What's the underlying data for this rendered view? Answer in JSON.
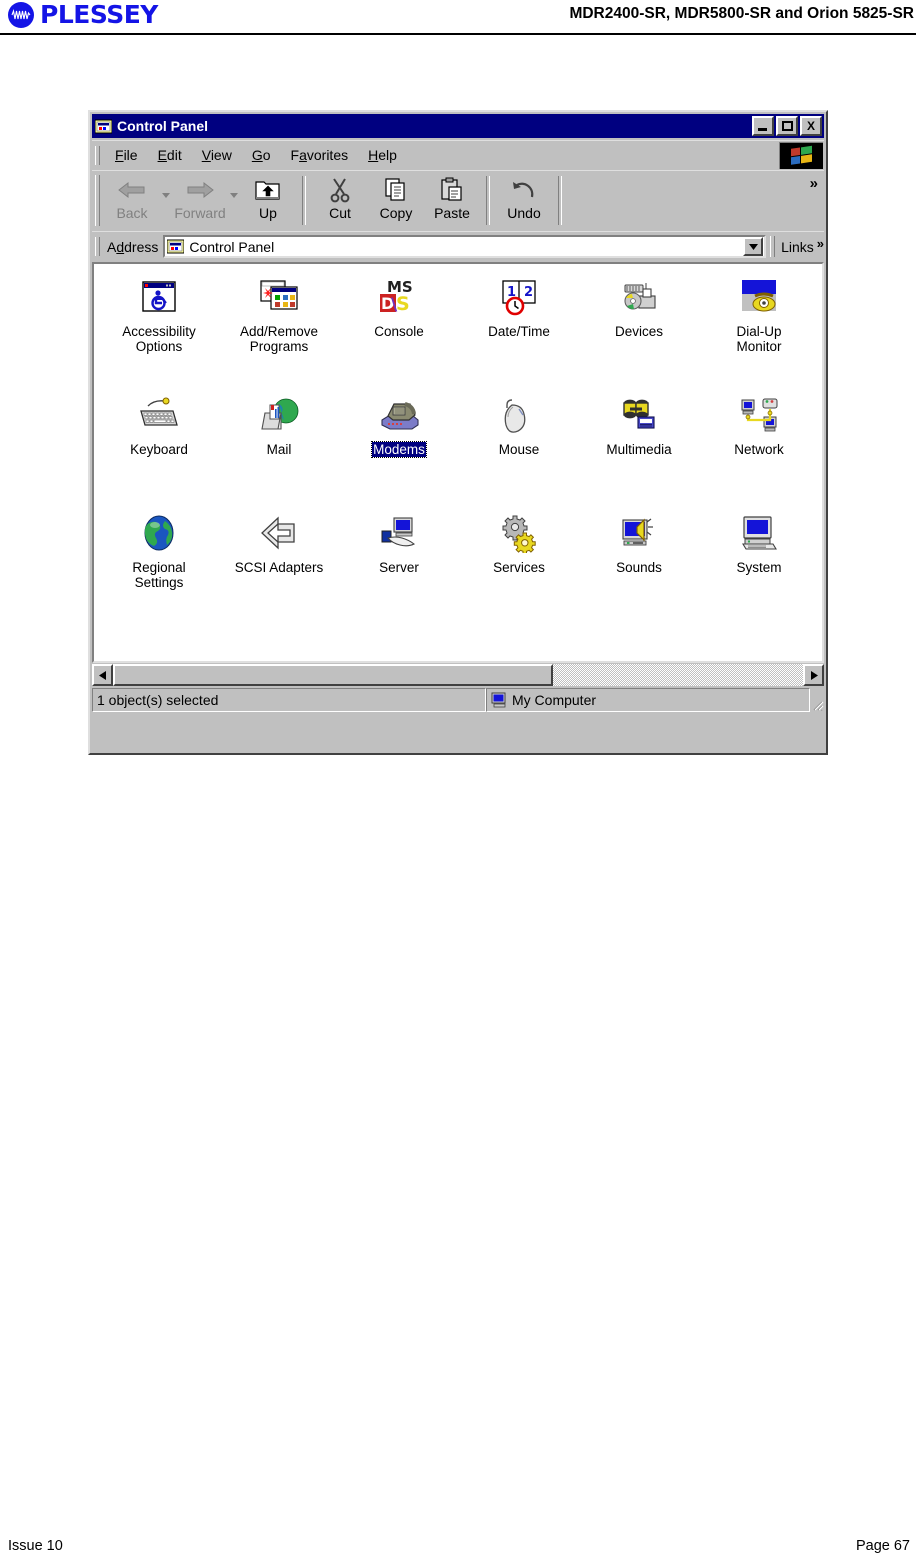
{
  "page": {
    "brand_name": "PLESSEY",
    "doc_title": "MDR2400-SR, MDR5800-SR and Orion 5825-SR",
    "footer_left": "Issue 10",
    "footer_right": "Page 67",
    "brand_color": "#1414e6"
  },
  "window": {
    "title": "Control Panel",
    "title_icon": "control-panel-folder-icon",
    "titlebar_color": "#000080",
    "buttons": {
      "minimize": "_",
      "maximize": "□",
      "close": "X"
    }
  },
  "menu": {
    "items": [
      {
        "label": "File",
        "accel": "F"
      },
      {
        "label": "Edit",
        "accel": "E"
      },
      {
        "label": "View",
        "accel": "V"
      },
      {
        "label": "Go",
        "accel": "G"
      },
      {
        "label": "Favorites",
        "accel": "a"
      },
      {
        "label": "Help",
        "accel": "H"
      }
    ],
    "logo": "windows-flag-logo"
  },
  "toolbar": {
    "buttons": [
      {
        "label": "Back",
        "icon": "back-arrow-icon",
        "disabled": true,
        "has_dropdown": true
      },
      {
        "label": "Forward",
        "icon": "forward-arrow-icon",
        "disabled": true,
        "has_dropdown": true
      },
      {
        "label": "Up",
        "icon": "up-folder-icon",
        "disabled": false,
        "has_dropdown": false
      },
      {
        "label": "Cut",
        "icon": "scissors-icon",
        "disabled": false,
        "has_dropdown": false
      },
      {
        "label": "Copy",
        "icon": "copy-pages-icon",
        "disabled": false,
        "has_dropdown": false
      },
      {
        "label": "Paste",
        "icon": "clipboard-paste-icon",
        "disabled": false,
        "has_dropdown": false
      },
      {
        "label": "Undo",
        "icon": "undo-arrow-icon",
        "disabled": false,
        "has_dropdown": false
      }
    ],
    "overflow_chevron": "»"
  },
  "address": {
    "label": "Address",
    "accel": "d",
    "value": "Control Panel",
    "icon": "control-panel-folder-icon",
    "dropdown_icon": "chevron-down-icon",
    "links_label": "Links",
    "links_chevron": "»"
  },
  "content": {
    "columns": 6,
    "items": [
      {
        "label": "Accessibility\nOptions",
        "icon": "accessibility-options-icon",
        "selected": false
      },
      {
        "label": "Add/Remove\nPrograms",
        "icon": "add-remove-programs-icon",
        "selected": false
      },
      {
        "label": "Console",
        "icon": "ms-dos-console-icon",
        "selected": false
      },
      {
        "label": "Date/Time",
        "icon": "date-time-icon",
        "selected": false
      },
      {
        "label": "Devices",
        "icon": "devices-icon",
        "selected": false
      },
      {
        "label": "Dial-Up\nMonitor",
        "icon": "dial-up-monitor-icon",
        "selected": false
      },
      {
        "label": "Keyboard",
        "icon": "keyboard-icon",
        "selected": false
      },
      {
        "label": "Mail",
        "icon": "mail-icon",
        "selected": false
      },
      {
        "label": "Modems",
        "icon": "modems-icon",
        "selected": true
      },
      {
        "label": "Mouse",
        "icon": "mouse-icon",
        "selected": false
      },
      {
        "label": "Multimedia",
        "icon": "multimedia-icon",
        "selected": false
      },
      {
        "label": "Network",
        "icon": "network-icon",
        "selected": false
      },
      {
        "label": "Regional\nSettings",
        "icon": "regional-settings-icon",
        "selected": false
      },
      {
        "label": "SCSI Adapters",
        "icon": "scsi-adapters-icon",
        "selected": false
      },
      {
        "label": "Server",
        "icon": "server-icon",
        "selected": false
      },
      {
        "label": "Services",
        "icon": "services-gears-icon",
        "selected": false
      },
      {
        "label": "Sounds",
        "icon": "sounds-icon",
        "selected": false
      },
      {
        "label": "System",
        "icon": "system-icon",
        "selected": false
      }
    ],
    "selection_color": "#000080"
  },
  "scrollbar": {
    "left_arrow": "◄",
    "right_arrow": "►"
  },
  "status": {
    "left_text": "1 object(s) selected",
    "right_text": "My Computer",
    "right_icon": "my-computer-icon"
  }
}
